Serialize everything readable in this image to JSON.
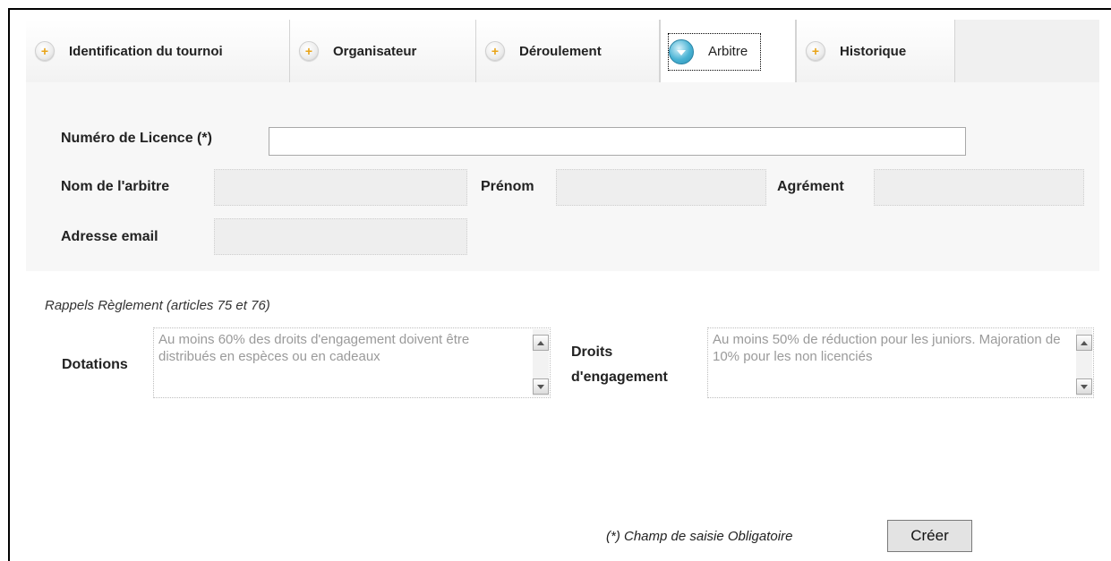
{
  "tabs": [
    {
      "label": "Identification du tournoi",
      "icon": "plus-icon",
      "active": false
    },
    {
      "label": "Organisateur",
      "icon": "plus-icon",
      "active": false
    },
    {
      "label": "Déroulement",
      "icon": "plus-icon",
      "active": false
    },
    {
      "label": "Arbitre",
      "icon": "chevron-down-icon",
      "active": true
    },
    {
      "label": "Historique",
      "icon": "plus-icon",
      "active": false
    }
  ],
  "form": {
    "licence_label": "Numéro de Licence (*)",
    "licence_value": "",
    "nom_label": "Nom de l'arbitre",
    "nom_value": "",
    "prenom_label": "Prénom",
    "prenom_value": "",
    "agrement_label": "Agrément",
    "agrement_value": "",
    "email_label": "Adresse email",
    "email_value": ""
  },
  "rappels": {
    "title": "Rappels Règlement (articles 75 et 76)",
    "dotations_label": "Dotations",
    "dotations_text": "Au moins 60% des droits d'engagement doivent être distribués en espèces ou en cadeaux",
    "droits_label_line1": "Droits",
    "droits_label_line2": "d'engagement",
    "droits_text": "Au moins 50% de réduction pour les juniors. Majoration de 10% pour les non licenciés"
  },
  "footer": {
    "required_note": "(*) Champ de saisie Obligatoire",
    "create_button": "Créer"
  },
  "colors": {
    "tab_icon_plus": "#e8a317",
    "tab_icon_active": "#4ab3d4",
    "panel_background": "#f7f7f7"
  }
}
